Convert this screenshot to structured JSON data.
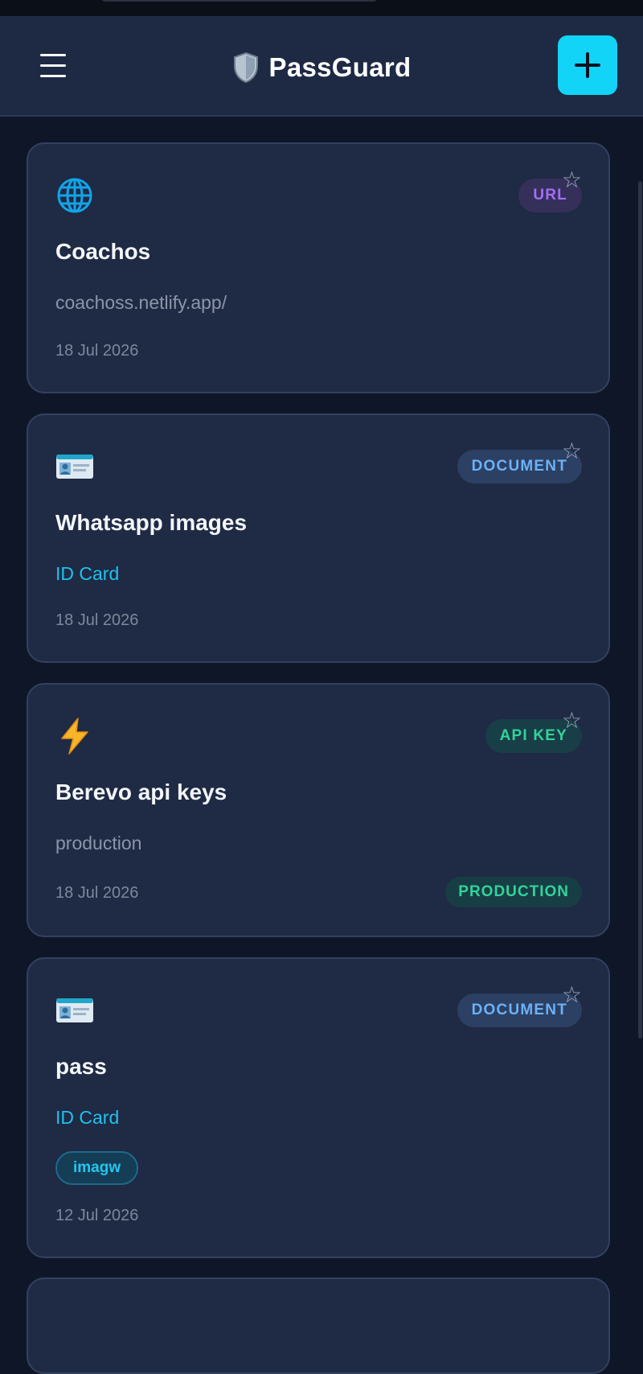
{
  "header": {
    "app_name": "PassGuard",
    "menu_icon": "hamburger-menu-icon",
    "add_icon": "plus-icon",
    "logo_icon": "shield-icon"
  },
  "colors": {
    "accent": "#12d4f6",
    "background": "#0f1627",
    "card": "#1f2a44"
  },
  "cards": [
    {
      "title": "Coachos",
      "subtitle": "coachoss.netlify.app/",
      "date": "18 Jul 2026",
      "type": "URL",
      "icon": "globe-icon",
      "starred": false
    },
    {
      "title": "Whatsapp images",
      "subtitle": "ID Card",
      "date": "18 Jul 2026",
      "type": "DOCUMENT",
      "icon": "id-card-icon",
      "starred": false
    },
    {
      "title": "Berevo api keys",
      "subtitle": "production",
      "date": "18 Jul 2026",
      "type": "API KEY",
      "environment": "PRODUCTION",
      "icon": "lightning-icon",
      "starred": false
    },
    {
      "title": "pass",
      "subtitle": "ID Card",
      "date": "12 Jul 2026",
      "type": "DOCUMENT",
      "tags": [
        "imagw"
      ],
      "icon": "id-card-icon",
      "starred": false
    }
  ]
}
